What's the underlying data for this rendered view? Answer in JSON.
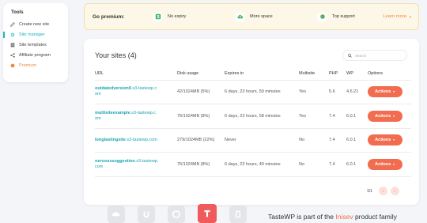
{
  "sidebar": {
    "title": "Tools",
    "items": [
      {
        "label": "Create new site",
        "icon": "pencil-icon"
      },
      {
        "label": "Site manager",
        "icon": "gear-icon",
        "active": true
      },
      {
        "label": "Site templates",
        "icon": "stack-icon"
      },
      {
        "label": "Affiliate program",
        "icon": "share-icon"
      },
      {
        "label": "Premium",
        "icon": "star-icon",
        "premium": true
      }
    ]
  },
  "banner": {
    "label": "Go premium:",
    "features": [
      {
        "label": "No expiry",
        "icon": "dollar-icon"
      },
      {
        "label": "More space",
        "icon": "cloud-upload-icon"
      },
      {
        "label": "Top support",
        "icon": "support-icon"
      }
    ],
    "learn_more": "Learn more"
  },
  "sites": {
    "heading": "Your sites (4)",
    "search_placeholder": "Search",
    "columns": [
      "URL",
      "Disk usage",
      "Expires in",
      "Multisite",
      "PHP",
      "WP",
      "Options"
    ],
    "rows": [
      {
        "name": "outdatedversion9",
        "domain": ".s3-tastewp.c",
        "domain2": "om",
        "disk": "42/1024MB (5%)",
        "expires": "6 days, 23 hours, 59 minutes",
        "multisite": "Yes",
        "php": "5.6",
        "wp": "4.6.21"
      },
      {
        "name": "multisiteexample",
        "domain": ".s3-tastewp.c",
        "domain2": "om",
        "disk": "76/1024MB (8%)",
        "expires": "6 days, 23 hours, 58 minutes",
        "multisite": "Yes",
        "php": "7.4",
        "wp": "6.0.1"
      },
      {
        "name": "longlastingsite",
        "domain": ".s3-tastewp.com",
        "domain2": "",
        "disk": "279/1024MB (22%)",
        "expires": "Never",
        "multisite": "No",
        "php": "7.4",
        "wp": "6.0.1"
      },
      {
        "name": "nervoussuggestion",
        "domain": ".s3-tastewp.",
        "domain2": "com",
        "disk": "76/1024MB (8%)",
        "expires": "6 days, 23 hours, 49 minutes",
        "multisite": "No",
        "php": "7.4",
        "wp": "6.0.1"
      }
    ],
    "action_label": "Actions",
    "pagination": {
      "text": "1/1",
      "prev": "‹",
      "next": "›"
    }
  },
  "footer": {
    "text_prefix": "TasteWP is part of the ",
    "brand": "Inisev",
    "text_suffix": " product family"
  }
}
